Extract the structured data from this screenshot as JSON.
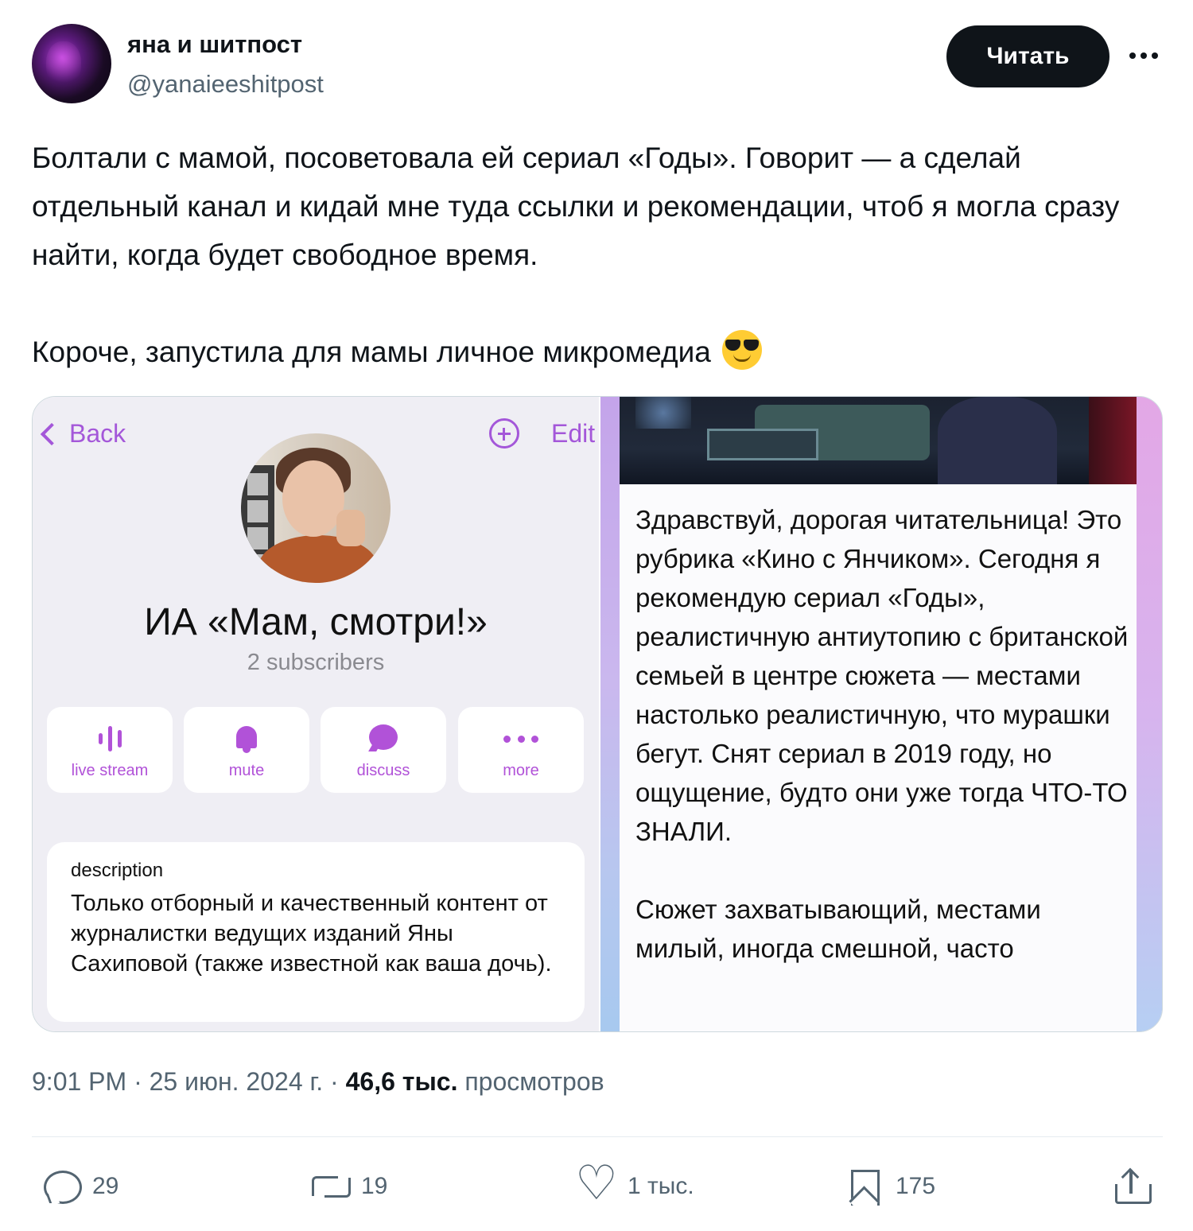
{
  "author": {
    "display_name": "яна и шитпост",
    "handle": "@yanaieeshitpost",
    "follow_label": "Читать"
  },
  "tweet": {
    "paragraph_1": "Болтали с мамой, посоветовала ей сериал «Годы». Говорит — а сделай отдельный канал и кидай мне туда ссылки и рекомендации, чтоб я могла сразу найти, когда будет свободное время.",
    "paragraph_2": "Короче, запустила для мамы личное микромедиа",
    "emoji": "smiling-face-with-sunglasses"
  },
  "media": {
    "left": {
      "back_label": "Back",
      "edit_label": "Edit",
      "channel_title": "ИА «Мам, смотри!»",
      "subscribers": "2 subscribers",
      "actions": [
        {
          "label": "live stream",
          "icon": "live-stream-icon"
        },
        {
          "label": "mute",
          "icon": "bell-icon"
        },
        {
          "label": "discuss",
          "icon": "chat-bubble-icon"
        },
        {
          "label": "more",
          "icon": "more-dots-icon"
        }
      ],
      "description_label": "description",
      "description_text": "Только отборный и качественный контент от журналистки ведущих изданий Яны Сахиповой (также известной как ваша дочь)."
    },
    "right": {
      "paragraph_1": "Здравствуй, дорогая читательница! Это рубрика «Кино с Янчиком». Сегодня я рекомендую сериал «Годы», реалистичную антиутопию с британской семьей в центре сюжета — местами настолько реалистичную, что мурашки бегут. Снят сериал в 2019 году, но ощущение, будто они уже тогда ЧТО-ТО ЗНАЛИ.",
      "paragraph_2": "Сюжет захватывающий, местами милый, иногда смешной, часто"
    }
  },
  "meta": {
    "time": "9:01 PM",
    "date": "25 июн. 2024 г.",
    "views_count": "46,6 тыс.",
    "views_label": "просмотров"
  },
  "actions": {
    "replies": "29",
    "reposts": "19",
    "likes": "1 тыс.",
    "bookmarks": "175"
  },
  "colors": {
    "accent_purple": "#a457d9",
    "button_dark": "#0f1419",
    "secondary_text": "#536471"
  }
}
